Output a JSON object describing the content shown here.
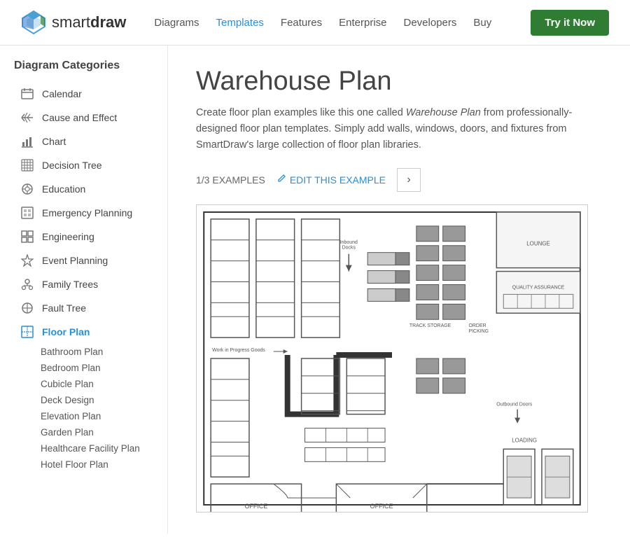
{
  "header": {
    "logo_smart": "smart",
    "logo_draw": "draw",
    "nav_items": [
      {
        "label": "Diagrams",
        "active": false
      },
      {
        "label": "Templates",
        "active": true
      },
      {
        "label": "Features",
        "active": false
      },
      {
        "label": "Enterprise",
        "active": false
      },
      {
        "label": "Developers",
        "active": false
      },
      {
        "label": "Buy",
        "active": false
      }
    ],
    "try_button": "Try it Now"
  },
  "sidebar": {
    "title": "Diagram Categories",
    "items": [
      {
        "label": "Calendar",
        "icon": "☰",
        "active": false
      },
      {
        "label": "Cause and Effect",
        "icon": "⊞",
        "active": false
      },
      {
        "label": "Chart",
        "icon": "📊",
        "active": false
      },
      {
        "label": "Decision Tree",
        "icon": "⊟",
        "active": false
      },
      {
        "label": "Education",
        "icon": "⚙",
        "active": false
      },
      {
        "label": "Emergency Planning",
        "icon": "⊡",
        "active": false
      },
      {
        "label": "Engineering",
        "icon": "⊞",
        "active": false
      },
      {
        "label": "Event Planning",
        "icon": "✦",
        "active": false
      },
      {
        "label": "Family Trees",
        "icon": "👤",
        "active": false
      },
      {
        "label": "Fault Tree",
        "icon": "⊕",
        "active": false
      },
      {
        "label": "Floor Plan",
        "icon": "⊘",
        "active": true
      }
    ],
    "sub_items": [
      {
        "label": "Bathroom Plan",
        "active": false
      },
      {
        "label": "Bedroom Plan",
        "active": false
      },
      {
        "label": "Cubicle Plan",
        "active": false
      },
      {
        "label": "Deck Design",
        "active": false
      },
      {
        "label": "Elevation Plan",
        "active": false
      },
      {
        "label": "Garden Plan",
        "active": false
      },
      {
        "label": "Healthcare Facility Plan",
        "active": false
      },
      {
        "label": "Hotel Floor Plan",
        "active": false
      }
    ]
  },
  "content": {
    "title": "Warehouse Plan",
    "description_1": "Create floor plan examples like this one called ",
    "description_italic": "Warehouse Plan",
    "description_2": " from professionally-designed floor plan templates. Simply add walls, windows, doors, and fixtures from SmartDraw's large collection of floor plan libraries.",
    "example_counter": "1/3 EXAMPLES",
    "edit_label": "EDIT THIS EXAMPLE",
    "next_button_label": "›"
  },
  "colors": {
    "accent_blue": "#2a8fd4",
    "green_btn": "#2e7d32",
    "text_dark": "#444",
    "text_mid": "#555",
    "border": "#ccc"
  }
}
